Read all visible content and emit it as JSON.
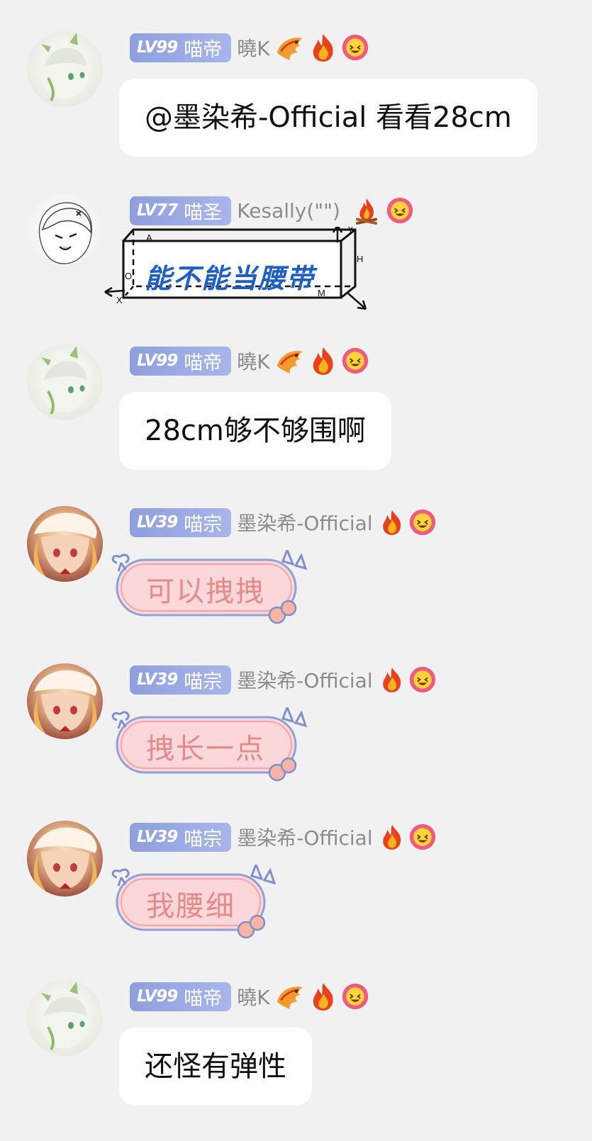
{
  "messages": [
    {
      "level": "LV99",
      "title": "喵帝",
      "name": "曉K",
      "type": "text",
      "text": "@墨染希-Official 看看28cm",
      "emojis": [
        "dragon-icon",
        "flame-icon",
        "laugh-face-icon"
      ]
    },
    {
      "level": "LV77",
      "title": "喵圣",
      "name": "Kesally(\"\")",
      "type": "box-sticker",
      "text": "能不能当腰带",
      "emojis": [
        "campfire-icon",
        "laugh-face-icon"
      ],
      "axes": {
        "a": "A",
        "o": "O",
        "x": "X",
        "y": "Y",
        "h": "H",
        "m": "M"
      }
    },
    {
      "level": "LV99",
      "title": "喵帝",
      "name": "曉K",
      "type": "text",
      "text": "28cm够不够围啊",
      "emojis": [
        "dragon-icon",
        "flame-icon",
        "laugh-face-icon"
      ]
    },
    {
      "level": "LV39",
      "title": "喵宗",
      "name": "墨染希-Official",
      "type": "pink-sticker",
      "text": "可以拽拽",
      "emojis": [
        "small-flame-icon",
        "laugh-face-icon"
      ]
    },
    {
      "level": "LV39",
      "title": "喵宗",
      "name": "墨染希-Official",
      "type": "pink-sticker",
      "text": "拽长一点",
      "emojis": [
        "small-flame-icon",
        "laugh-face-icon"
      ]
    },
    {
      "level": "LV39",
      "title": "喵宗",
      "name": "墨染希-Official",
      "type": "pink-sticker",
      "text": "我腰细",
      "emojis": [
        "small-flame-icon",
        "laugh-face-icon"
      ]
    },
    {
      "level": "LV99",
      "title": "喵帝",
      "name": "曉K",
      "type": "text",
      "text": "还怪有弹性",
      "emojis": [
        "dragon-icon",
        "flame-icon",
        "laugh-face-icon"
      ]
    }
  ],
  "colors": {
    "background": "#f1f1f1",
    "badge": "#9aaae3",
    "bubble": "#ffffff",
    "name": "#8c8c8c",
    "sticker_text": "#e58a8a",
    "box_text": "#1e5fc7"
  }
}
